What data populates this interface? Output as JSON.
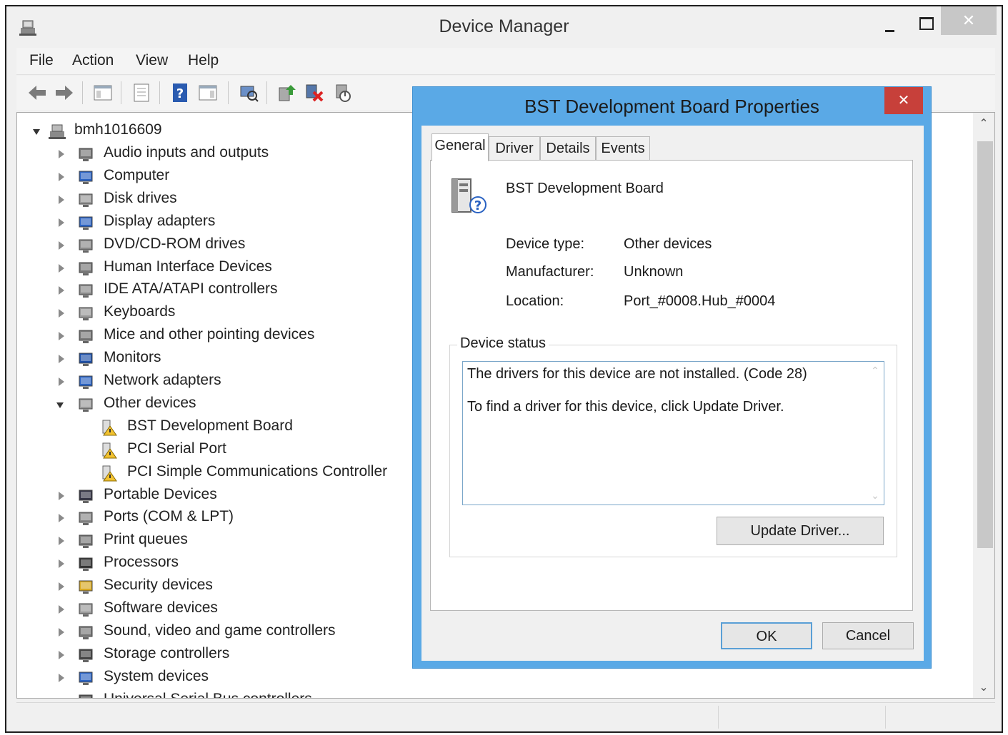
{
  "window": {
    "title": "Device Manager",
    "close_glyph": "✕"
  },
  "menu": [
    "File",
    "Action",
    "View",
    "Help"
  ],
  "tree": {
    "root": "bmh1016609",
    "items": [
      {
        "label": "Audio inputs and outputs",
        "icon": "speaker-icon"
      },
      {
        "label": "Computer",
        "icon": "computer-icon"
      },
      {
        "label": "Disk drives",
        "icon": "disk-drive-icon"
      },
      {
        "label": "Display adapters",
        "icon": "display-adapter-icon"
      },
      {
        "label": "DVD/CD-ROM drives",
        "icon": "dvd-drive-icon"
      },
      {
        "label": "Human Interface Devices",
        "icon": "hid-icon"
      },
      {
        "label": "IDE ATA/ATAPI controllers",
        "icon": "ide-controller-icon"
      },
      {
        "label": "Keyboards",
        "icon": "keyboard-icon"
      },
      {
        "label": "Mice and other pointing devices",
        "icon": "mouse-icon"
      },
      {
        "label": "Monitors",
        "icon": "monitor-icon"
      },
      {
        "label": "Network adapters",
        "icon": "network-adapter-icon"
      },
      {
        "label": "Other devices",
        "icon": "unknown-device-icon",
        "expanded": true
      },
      {
        "label": "BST Development Board",
        "icon": "warning-device-icon",
        "child": true
      },
      {
        "label": "PCI Serial Port",
        "icon": "warning-device-icon",
        "child": true
      },
      {
        "label": "PCI Simple Communications Controller",
        "icon": "warning-device-icon",
        "child": true
      },
      {
        "label": "Portable Devices",
        "icon": "portable-device-icon"
      },
      {
        "label": "Ports (COM & LPT)",
        "icon": "port-icon"
      },
      {
        "label": "Print queues",
        "icon": "printer-icon"
      },
      {
        "label": "Processors",
        "icon": "processor-icon"
      },
      {
        "label": "Security devices",
        "icon": "key-icon"
      },
      {
        "label": "Software devices",
        "icon": "software-device-icon"
      },
      {
        "label": "Sound, video and game controllers",
        "icon": "speaker-icon"
      },
      {
        "label": "Storage controllers",
        "icon": "storage-controller-icon"
      },
      {
        "label": "System devices",
        "icon": "computer-icon"
      },
      {
        "label": "Universal Serial Bus controllers",
        "icon": "usb-icon",
        "expanded": true
      }
    ]
  },
  "dialog": {
    "title": "BST Development Board Properties",
    "close_glyph": "✕",
    "tabs": [
      "General",
      "Driver",
      "Details",
      "Events"
    ],
    "device_name": "BST Development Board",
    "device_type_label": "Device type:",
    "device_type_value": "Other devices",
    "manufacturer_label": "Manufacturer:",
    "manufacturer_value": "Unknown",
    "location_label": "Location:",
    "location_value": "Port_#0008.Hub_#0004",
    "status_legend": "Device status",
    "status_line1": "The drivers for this device are not installed. (Code 28)",
    "status_line2": "To find a driver for this device, click Update Driver.",
    "update_button": "Update Driver...",
    "ok_button": "OK",
    "cancel_button": "Cancel"
  }
}
